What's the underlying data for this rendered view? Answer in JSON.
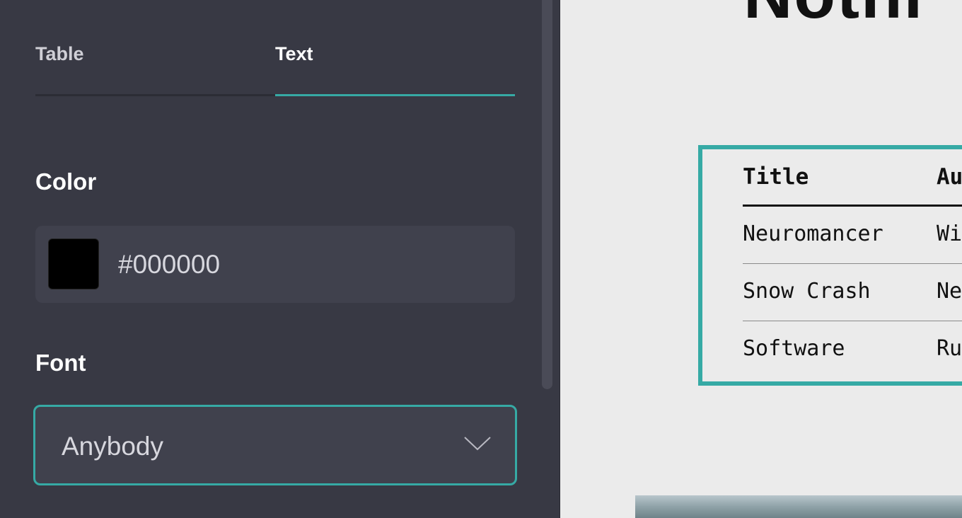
{
  "sidebar": {
    "tabs": [
      {
        "label": "Table",
        "active": false
      },
      {
        "label": "Text",
        "active": true
      }
    ],
    "color": {
      "label": "Color",
      "value": "#000000",
      "swatch": "#000000"
    },
    "font": {
      "label": "Font",
      "value": "Anybody",
      "icon": "chevron-down-icon"
    }
  },
  "preview": {
    "heading": "Nothi",
    "table": {
      "headers": [
        "Title",
        "Au"
      ],
      "rows": [
        [
          "Neuromancer",
          "Wi"
        ],
        [
          "Snow Crash",
          "Ne"
        ],
        [
          "Software",
          "Ru"
        ]
      ]
    }
  },
  "colors": {
    "accent": "#36aaa5",
    "panel_bg": "#383944",
    "field_bg": "#40414d",
    "canvas_bg": "#ebebeb"
  }
}
